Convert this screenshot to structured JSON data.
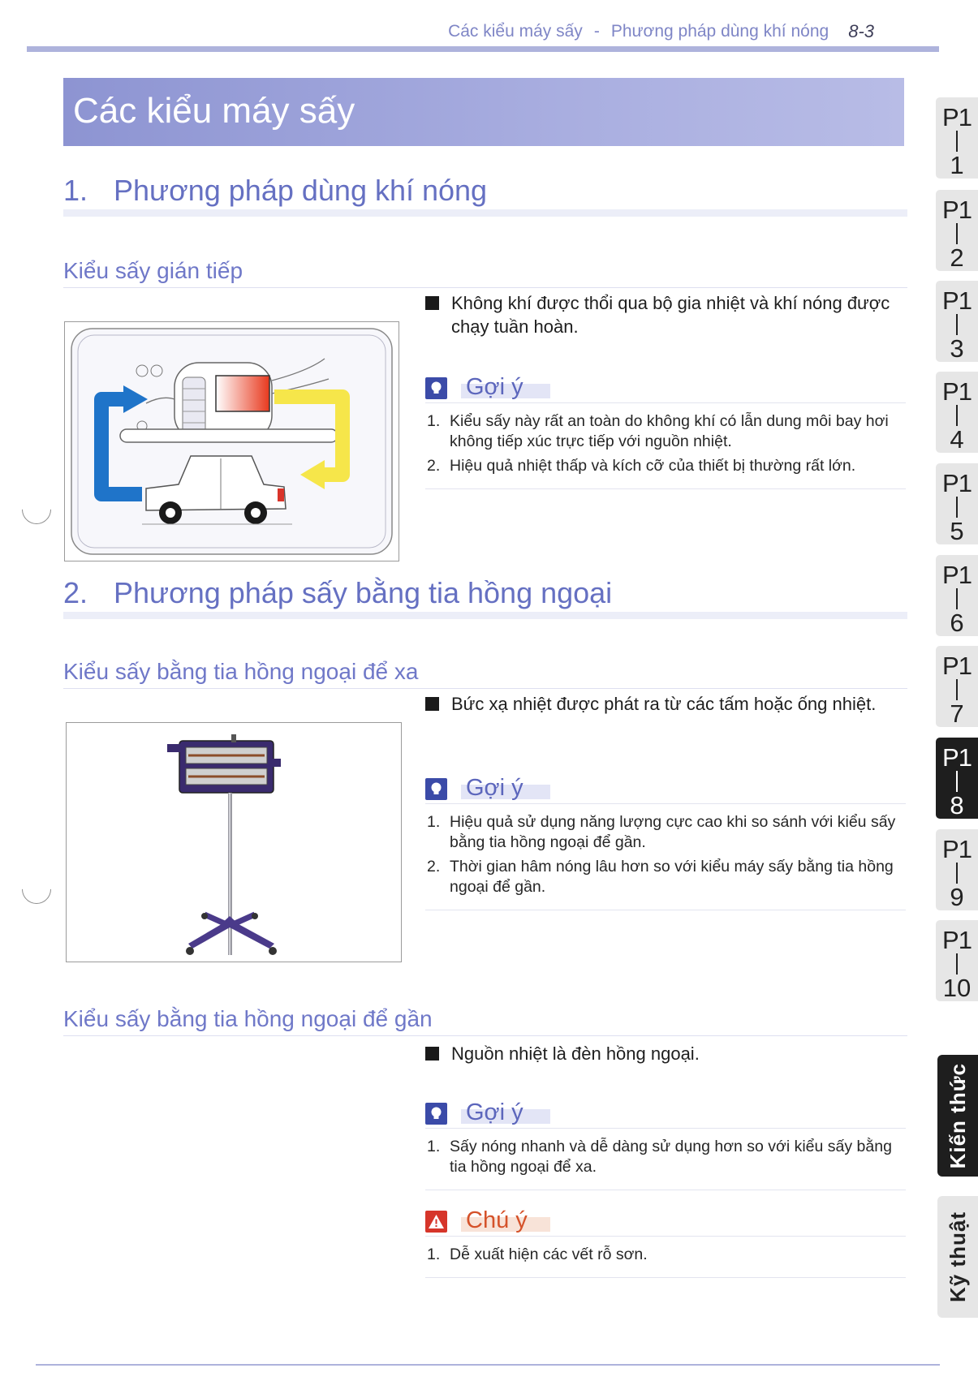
{
  "header": {
    "crumb1": "Các kiểu máy sấy",
    "separator": "-",
    "crumb2": "Phương pháp dùng khí nóng",
    "page": "8-3"
  },
  "banner": {
    "title": "Các kiểu máy sấy"
  },
  "section1": {
    "num": "1.",
    "title": "Phương pháp dùng khí nóng",
    "sub1": {
      "title": "Kiểu sấy gián tiếp",
      "bullet": "Không khí được thổi qua bộ gia nhiệt và khí nóng được chạy tuần hoàn.",
      "tip_title": "Gợi ý",
      "tips": [
        {
          "n": "1.",
          "text": "Kiểu sấy này rất an toàn do không khí có lẫn dung môi bay hơi không tiếp xúc trực tiếp với nguồn nhiệt."
        },
        {
          "n": "2.",
          "text": "Hiệu quả nhiệt thấp và kích cỡ của thiết bị thường rất lớn."
        }
      ]
    }
  },
  "section2": {
    "num": "2.",
    "title": "Phương pháp sấy bằng tia hồng ngoại",
    "sub1": {
      "title": "Kiểu sấy bằng tia hồng ngoại để xa",
      "bullet": "Bức xạ nhiệt được phát ra từ các tấm hoặc ống nhiệt.",
      "tip_title": "Gợi ý",
      "tips": [
        {
          "n": "1.",
          "text": "Hiệu quả sử dụng năng lượng cực cao khi so sánh với kiểu sấy bằng tia hồng ngoại để gần."
        },
        {
          "n": "2.",
          "text": "Thời gian hâm nóng lâu hơn so với kiểu máy sấy bằng tia hồng ngoại để gần."
        }
      ]
    },
    "sub2": {
      "title": "Kiểu sấy bằng tia hồng ngoại để gần",
      "bullet": "Nguồn nhiệt là đèn hồng ngoại.",
      "tip_title": "Gợi ý",
      "tips": [
        {
          "n": "1.",
          "text": "Sấy nóng nhanh và dễ dàng sử dụng hơn so với kiểu sấy bằng tia hồng ngoại để xa."
        }
      ],
      "warn_title": "Chú ý",
      "warns": [
        {
          "n": "1.",
          "text": "Dễ xuất hiện các vết rỗ sơn."
        }
      ]
    }
  },
  "tabs": [
    {
      "p": "P1",
      "n": "1"
    },
    {
      "p": "P1",
      "n": "2"
    },
    {
      "p": "P1",
      "n": "3"
    },
    {
      "p": "P1",
      "n": "4"
    },
    {
      "p": "P1",
      "n": "5"
    },
    {
      "p": "P1",
      "n": "6"
    },
    {
      "p": "P1",
      "n": "7"
    },
    {
      "p": "P1",
      "n": "8",
      "active": true
    },
    {
      "p": "P1",
      "n": "9"
    },
    {
      "p": "P1",
      "n": "10"
    }
  ],
  "side_tabs": {
    "knowledge": "Kiến thức",
    "technique": "Kỹ thuật"
  },
  "colors": {
    "accent": "#6570c2",
    "banner": "#8d94d2",
    "tip_icon": "#3b4ba8",
    "warn": "#d5522a",
    "active_tab": "#1e1e1e"
  }
}
